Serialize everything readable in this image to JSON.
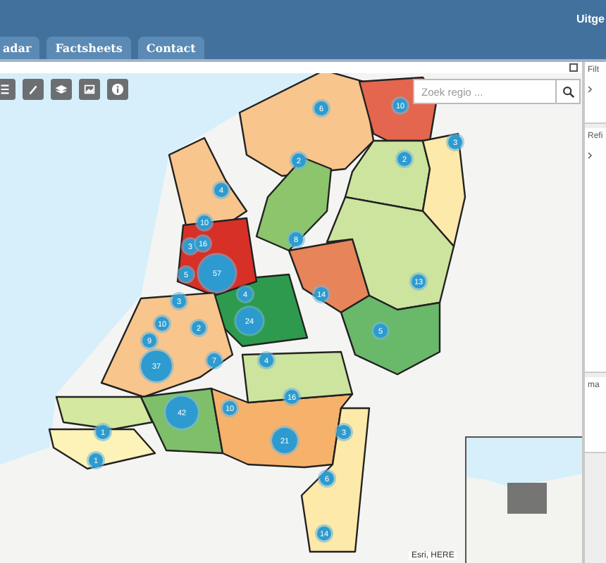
{
  "header": {
    "user_label": "Uitge"
  },
  "tabs": [
    {
      "label": "adar",
      "selected": false
    },
    {
      "label": "Factsheets",
      "selected": false
    },
    {
      "label": "Contact",
      "selected": false
    }
  ],
  "search": {
    "placeholder": "Zoek regio ..."
  },
  "regions": [
    {
      "color": "#f8c58d"
    },
    {
      "color": "#e4664f"
    },
    {
      "color": "#cde49e"
    },
    {
      "color": "#fde9a9"
    },
    {
      "color": "#8cc56b"
    },
    {
      "color": "#cde49e"
    },
    {
      "color": "#e8845a"
    },
    {
      "color": "#6ab86a"
    },
    {
      "color": "#2e9a4e"
    },
    {
      "color": "#f8c58d"
    },
    {
      "color": "#d73027"
    },
    {
      "color": "#f8c58d"
    },
    {
      "color": "#d4e8a0"
    },
    {
      "color": "#fdf3b8"
    },
    {
      "color": "#7fbf6a"
    },
    {
      "color": "#f6b26b"
    },
    {
      "color": "#cde49e"
    },
    {
      "color": "#fde9a9"
    }
  ],
  "clusters": [
    {
      "count": "6"
    },
    {
      "count": "10"
    },
    {
      "count": "3"
    },
    {
      "count": "2"
    },
    {
      "count": "2"
    },
    {
      "count": "4"
    },
    {
      "count": "10"
    },
    {
      "count": "3"
    },
    {
      "count": "16"
    },
    {
      "count": "8"
    },
    {
      "count": "5"
    },
    {
      "count": "57"
    },
    {
      "count": "13"
    },
    {
      "count": "4"
    },
    {
      "count": "14"
    },
    {
      "count": "3"
    },
    {
      "count": "10"
    },
    {
      "count": "2"
    },
    {
      "count": "24"
    },
    {
      "count": "5"
    },
    {
      "count": "9"
    },
    {
      "count": "37"
    },
    {
      "count": "7"
    },
    {
      "count": "4"
    },
    {
      "count": "16"
    },
    {
      "count": "42"
    },
    {
      "count": "10"
    },
    {
      "count": "1"
    },
    {
      "count": "21"
    },
    {
      "count": "3"
    },
    {
      "count": "1"
    },
    {
      "count": "6"
    },
    {
      "count": "14"
    }
  ],
  "attribution": "Esri, HERE",
  "side_panel": [
    {
      "title": "Filt"
    },
    {
      "title": "Refi"
    },
    {
      "title": "ma"
    }
  ]
}
